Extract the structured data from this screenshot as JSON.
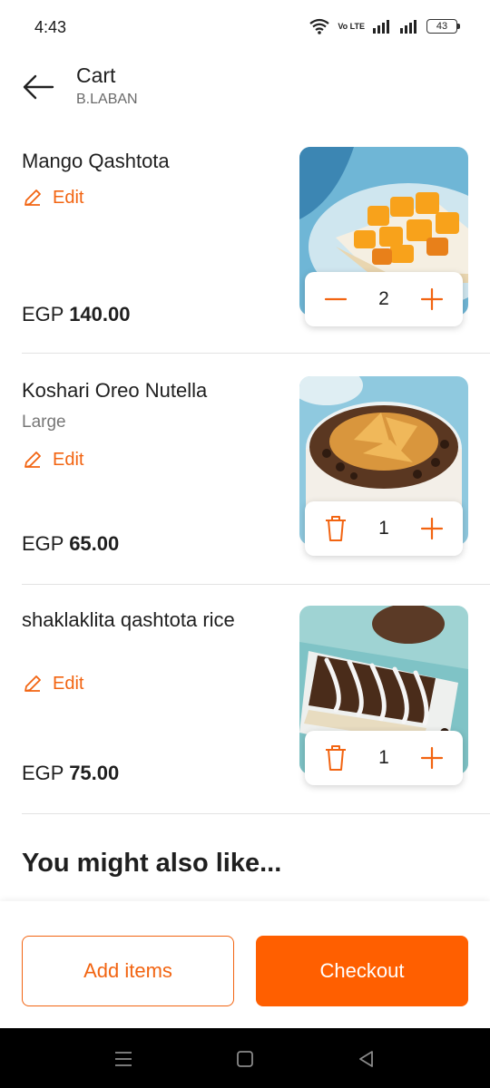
{
  "status": {
    "time": "4:43",
    "battery": "43",
    "volte": "Vo LTE"
  },
  "header": {
    "title": "Cart",
    "restaurant": "B.LABAN"
  },
  "items": [
    {
      "name": "Mango Qashtota",
      "variant": "",
      "edit_label": "Edit",
      "currency": "EGP",
      "price": "140.00",
      "quantity": "2"
    },
    {
      "name": "Koshari Oreo Nutella",
      "variant": "Large",
      "edit_label": "Edit",
      "currency": "EGP",
      "price": "65.00",
      "quantity": "1"
    },
    {
      "name": "shaklaklita qashtota rice",
      "variant": "",
      "edit_label": "Edit",
      "currency": "EGP",
      "price": "75.00",
      "quantity": "1"
    }
  ],
  "suggestions": {
    "title": "You might also like..."
  },
  "actions": {
    "add_items": "Add items",
    "checkout": "Checkout"
  },
  "colors": {
    "accent": "#ff5f00",
    "accent_text": "#f26411"
  }
}
